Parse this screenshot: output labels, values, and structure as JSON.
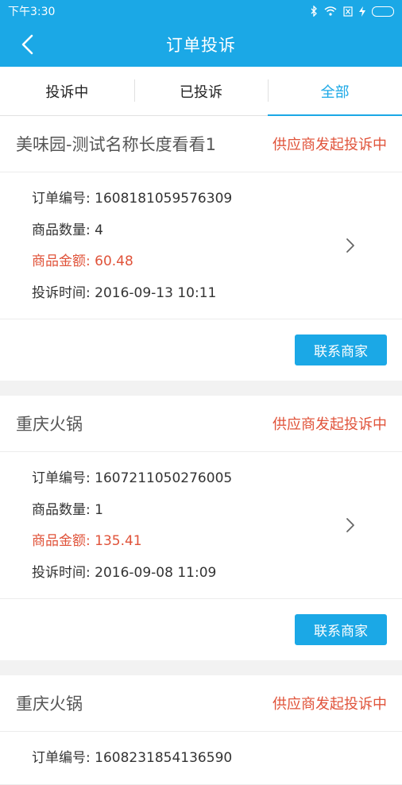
{
  "status_bar": {
    "time": "下午3:30"
  },
  "header": {
    "title": "订单投诉"
  },
  "tabs": [
    {
      "label": "投诉中",
      "active": false
    },
    {
      "label": "已投诉",
      "active": false
    },
    {
      "label": "全部",
      "active": true
    }
  ],
  "labels": {
    "order_no": "订单编号: ",
    "quantity": "商品数量: ",
    "amount": "商品金额: ",
    "time": "投诉时间: ",
    "contact_button": "联系商家"
  },
  "orders": [
    {
      "shop": "美味园-测试名称长度看看1",
      "status": "供应商发起投诉中",
      "order_no": "1608181059576309",
      "quantity": "4",
      "amount": "60.48",
      "complaint_time": "2016-09-13 10:11"
    },
    {
      "shop": "重庆火锅",
      "status": "供应商发起投诉中",
      "order_no": "1607211050276005",
      "quantity": "1",
      "amount": "135.41",
      "complaint_time": "2016-09-08 11:09"
    },
    {
      "shop": "重庆火锅",
      "status": "供应商发起投诉中",
      "order_no": "1608231854136590",
      "quantity": "",
      "amount": "",
      "complaint_time": ""
    }
  ],
  "colors": {
    "primary": "#1ba8e6",
    "status": "#e0533a"
  },
  "icons": [
    "back-arrow-icon",
    "chevron-right-icon",
    "bluetooth-icon",
    "wifi-icon",
    "sim-icon",
    "charging-icon",
    "battery-icon"
  ]
}
